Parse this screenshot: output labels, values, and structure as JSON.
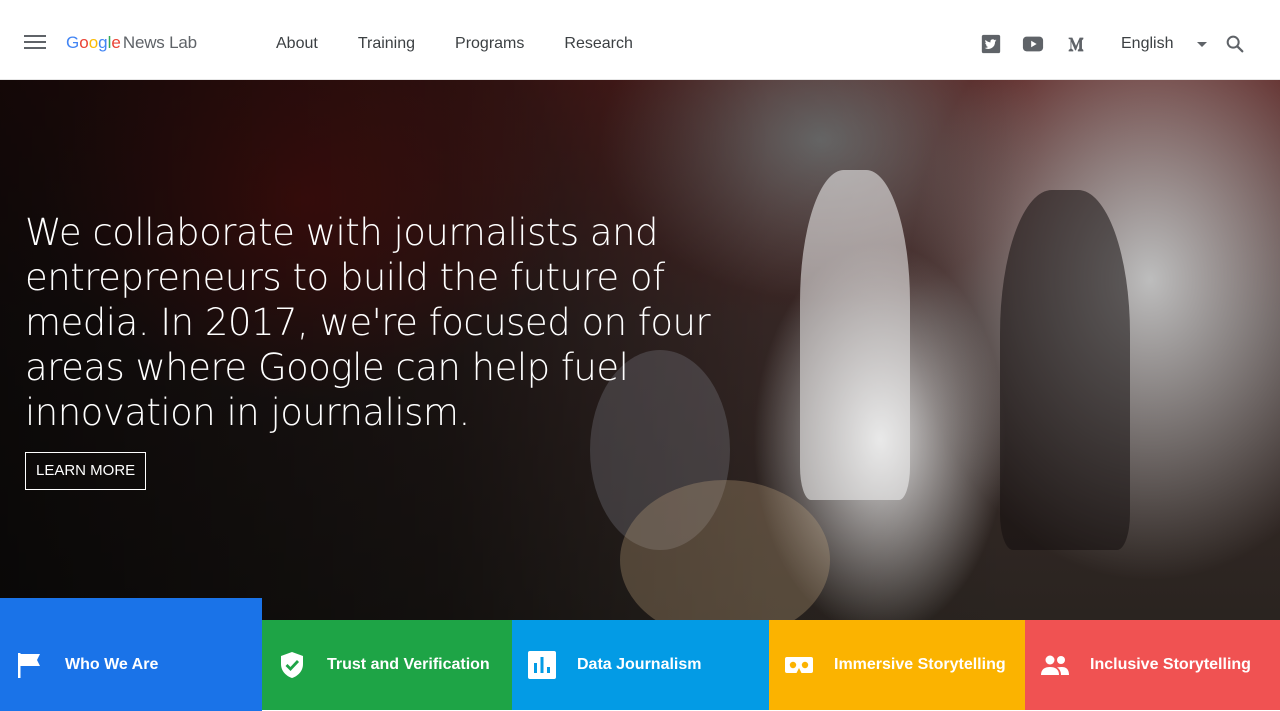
{
  "header": {
    "logo_google": [
      "G",
      "o",
      "o",
      "g",
      "l",
      "e"
    ],
    "logo_suffix": "News Lab",
    "nav": [
      {
        "label": "About"
      },
      {
        "label": "Training"
      },
      {
        "label": "Programs"
      },
      {
        "label": "Research"
      }
    ],
    "social_icons": [
      "twitter-icon",
      "youtube-icon",
      "medium-icon"
    ],
    "language": "English",
    "search_icon": "search-icon",
    "menu_icon": "hamburger-menu-icon"
  },
  "hero": {
    "headline": "We collaborate with journalists and entrepreneurs to build the future of media. In 2017, we're focused on four areas where Google can help fuel innovation in journalism.",
    "cta_label": "LEARN MORE"
  },
  "tiles": [
    {
      "label": "Who We Are",
      "icon": "flag-icon",
      "color": "#1a73e8"
    },
    {
      "label": "Trust and Verification",
      "icon": "shield-check-icon",
      "color": "#1ea446"
    },
    {
      "label": "Data Journalism",
      "icon": "bar-chart-icon",
      "color": "#039be5"
    },
    {
      "label": "Immersive Storytelling",
      "icon": "vr-headset-icon",
      "color": "#fbb300"
    },
    {
      "label": "Inclusive Storytelling",
      "icon": "people-icon",
      "color": "#f05252"
    }
  ]
}
